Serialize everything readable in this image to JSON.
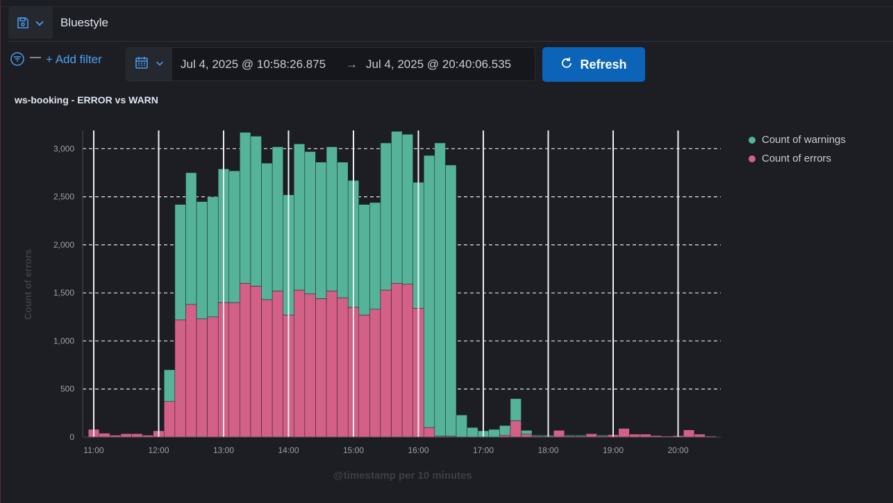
{
  "query_bar": {
    "saved_query_icon": "save-icon",
    "query_text": "Bluestyle"
  },
  "filters": {
    "filter_icon": "filter-icon",
    "dash": "—",
    "add_filter_label": "+ Add filter"
  },
  "date_picker": {
    "calendar_icon": "calendar-icon",
    "start": "Jul 4, 2025 @ 10:58:26.875",
    "arrow": "→",
    "end": "Jul 4, 2025 @ 20:40:06.535"
  },
  "refresh": {
    "label": "Refresh",
    "icon": "refresh-icon",
    "color": "#0b64b7"
  },
  "panel": {
    "title": "ws-booking - ERROR vs WARN"
  },
  "chart_data": {
    "type": "bar",
    "stacked": true,
    "title": "ws-booking - ERROR vs WARN",
    "xlabel": "@timestamp per 10 minutes",
    "ylabel": "Count of errors",
    "ylim": [
      0,
      3190
    ],
    "yticks": [
      0,
      500,
      1000,
      1500,
      2000,
      2500,
      3000
    ],
    "ytick_labels": [
      "0",
      "500",
      "1,000",
      "1,500",
      "2,000",
      "2,500",
      "3,000"
    ],
    "xtick_labels": [
      "11:00",
      "12:00",
      "13:00",
      "14:00",
      "15:00",
      "16:00",
      "17:00",
      "18:00",
      "19:00",
      "20:00"
    ],
    "grid": "horizontal dashed",
    "legend_position": "right",
    "categories": [
      "11:00",
      "11:10",
      "11:20",
      "11:30",
      "11:40",
      "11:50",
      "12:00",
      "12:10",
      "12:20",
      "12:30",
      "12:40",
      "12:50",
      "13:00",
      "13:10",
      "13:20",
      "13:30",
      "13:40",
      "13:50",
      "14:00",
      "14:10",
      "14:20",
      "14:30",
      "14:40",
      "14:50",
      "15:00",
      "15:10",
      "15:20",
      "15:30",
      "15:40",
      "15:50",
      "16:00",
      "16:10",
      "16:20",
      "16:30",
      "16:40",
      "16:50",
      "17:00",
      "17:10",
      "17:20",
      "17:30",
      "17:40",
      "17:50",
      "18:00",
      "18:10",
      "18:20",
      "18:30",
      "18:40",
      "18:50",
      "19:00",
      "19:10",
      "19:20",
      "19:30",
      "19:40",
      "19:50",
      "20:00",
      "20:10",
      "20:20",
      "20:30"
    ],
    "series": [
      {
        "name": "Count of errors",
        "color": "#d36086",
        "values": [
          80,
          40,
          20,
          35,
          35,
          20,
          65,
          370,
          1220,
          1380,
          1230,
          1250,
          1400,
          1400,
          1600,
          1570,
          1430,
          1520,
          1270,
          1530,
          1490,
          1440,
          1520,
          1450,
          1350,
          1270,
          1330,
          1530,
          1600,
          1590,
          1340,
          100,
          10,
          10,
          0,
          0,
          0,
          0,
          20,
          170,
          30,
          10,
          10,
          70,
          10,
          10,
          35,
          10,
          25,
          90,
          30,
          30,
          15,
          10,
          15,
          75,
          30,
          10
        ]
      },
      {
        "name": "Count of warnings",
        "color": "#54b399",
        "values": [
          0,
          0,
          0,
          0,
          0,
          0,
          0,
          330,
          1200,
          1370,
          1220,
          1250,
          1390,
          1370,
          1570,
          1560,
          1420,
          1500,
          1250,
          1520,
          1480,
          1420,
          1500,
          1410,
          1320,
          1150,
          1110,
          1530,
          1580,
          1560,
          1310,
          2830,
          3050,
          2820,
          230,
          100,
          65,
          80,
          100,
          230,
          40,
          10,
          10,
          0,
          10,
          10,
          0,
          10,
          0,
          0,
          0,
          0,
          0,
          0,
          0,
          0,
          0,
          0
        ]
      }
    ]
  }
}
